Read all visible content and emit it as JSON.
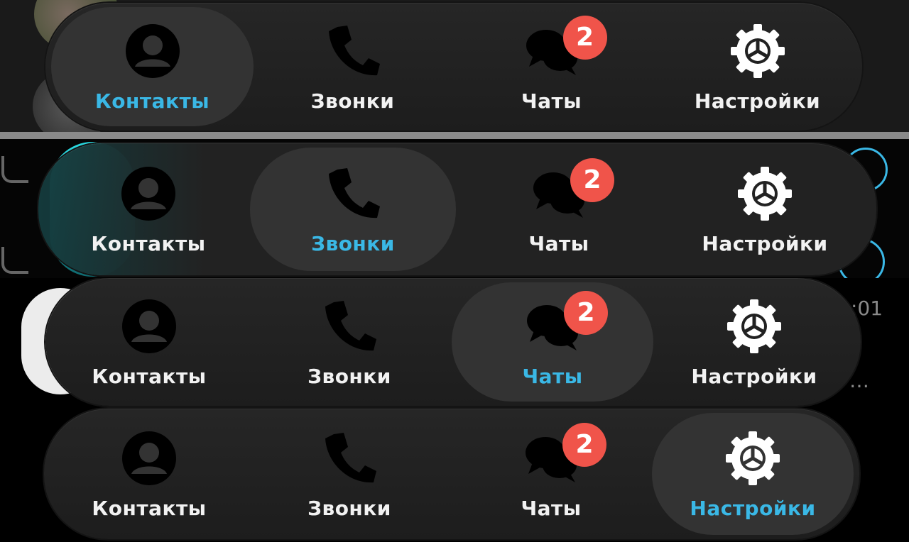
{
  "tabs": [
    {
      "label": "Контакты",
      "icon": "person-icon"
    },
    {
      "label": "Звонки",
      "icon": "phone-icon"
    },
    {
      "label": "Чаты",
      "icon": "chat-bubbles-icon",
      "badge": "2"
    },
    {
      "label": "Настройки",
      "icon": "gear-icon"
    }
  ],
  "background_fragments": {
    "timestamp": ":01",
    "ellipsis": "…"
  },
  "colors": {
    "selected_label": "#3ab8e6",
    "badge": "#f0544a",
    "bar": "#212121",
    "selected_pill": "#333333",
    "icon_dark": "#000000",
    "icon_light": "#ffffff"
  }
}
